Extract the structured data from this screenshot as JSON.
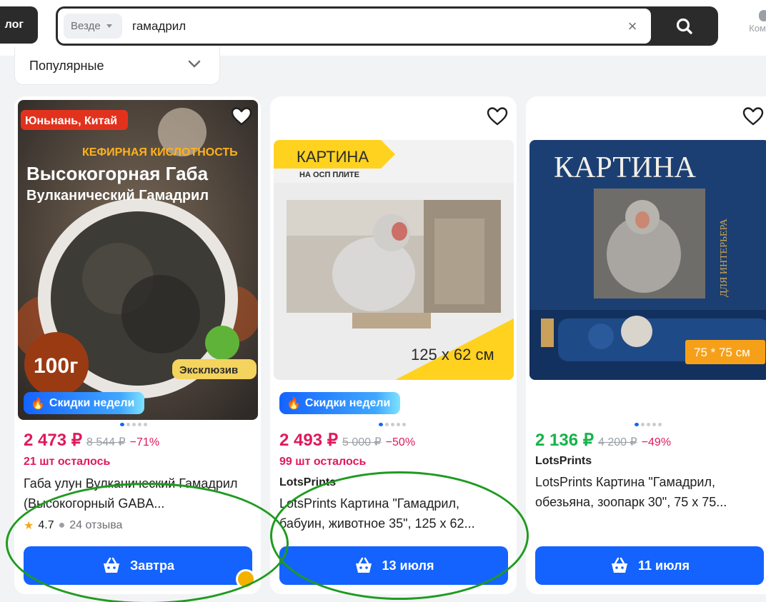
{
  "header": {
    "catalog_label": "лог",
    "search_scope": "Везде",
    "search_value": "гамадрил",
    "side_tool_label": "Ком"
  },
  "sort": {
    "label": "Популярные"
  },
  "products": [
    {
      "image": {
        "origin": "Юньнань, Китай",
        "sub": "КЕФИРНАЯ КИСЛОТНОСТЬ",
        "line1": "Высокогорная Габа",
        "line2": "Вулканический Гамадрил",
        "weight": "100г",
        "exclusive": "Эксклюзив"
      },
      "badge": "Скидки недели",
      "price": "2 473 ₽",
      "old_price": "8 544 ₽",
      "discount": "−71%",
      "stock": "21 шт осталось",
      "title": "Габа улун Вулканический Гамадрил (Высокогорный GABA...",
      "rating": "4.7",
      "reviews": "24 отзыва",
      "buy_label": "Завтра"
    },
    {
      "image": {
        "banner1": "КАРТИНА",
        "banner2": "НА ОСП ПЛИТЕ",
        "size": "125 x 62 см"
      },
      "badge": "Скидки недели",
      "price": "2 493 ₽",
      "old_price": "5 000 ₽",
      "discount": "−50%",
      "stock": "99 шт осталось",
      "seller": "LotsPrints",
      "title": "LotsPrints Картина \"Гамадрил, бабуин, животное 35\", 125 х 62...",
      "buy_label": "13 июля"
    },
    {
      "image": {
        "banner": "КАРТИНА",
        "side": "ДЛЯ ИНТЕРЬЕРА",
        "size": "75 * 75 см"
      },
      "price": "2 136 ₽",
      "old_price": "4 200 ₽",
      "discount": "−49%",
      "seller": "LotsPrints",
      "title": "LotsPrints Картина \"Гамадрил, обезьяна, зоопарк 30\", 75 х 75...",
      "buy_label": "11 июля"
    }
  ],
  "colors": {
    "accent": "#1463ff",
    "sale": "#e0195b",
    "green": "#16b34a"
  }
}
